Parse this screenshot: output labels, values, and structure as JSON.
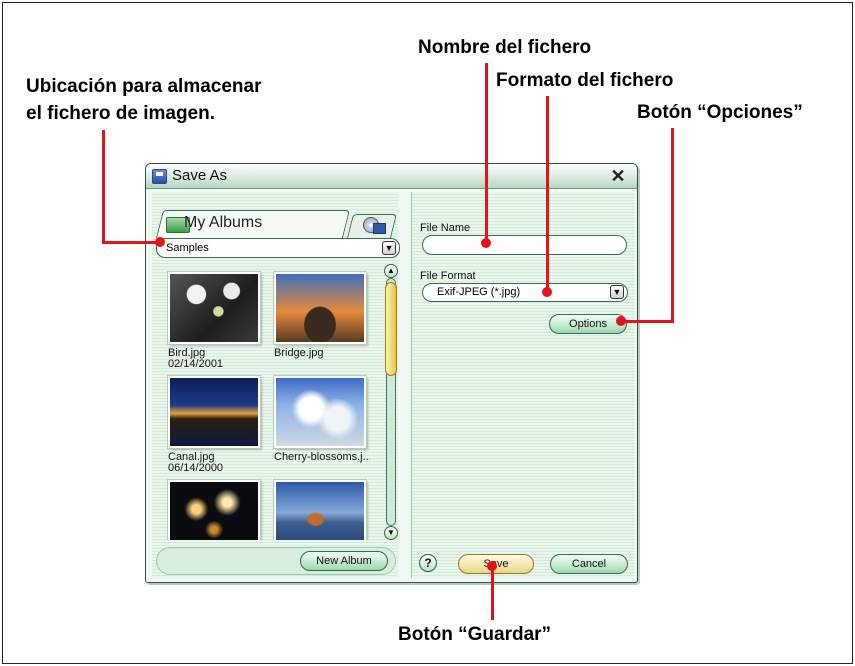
{
  "callouts": {
    "location_line1": "Ubicación para almacenar",
    "location_line2": "el fichero de imagen.",
    "file_name": "Nombre del fichero",
    "file_format": "Formato del fichero",
    "options_button": "Botón “Opciones”",
    "save_button": "Botón “Guardar”"
  },
  "dialog": {
    "title": "Save As",
    "close_glyph": "✕",
    "tabs": [
      {
        "label": "My Albums",
        "icon": "album-icon",
        "active": true
      },
      {
        "label": "",
        "icon": "disc-drive-icon",
        "active": false
      }
    ],
    "location": {
      "value": "Samples"
    },
    "thumbnails": [
      {
        "name": "Bird.jpg",
        "date": "02/14/2001"
      },
      {
        "name": "Bridge.jpg",
        "date": ""
      },
      {
        "name": "Canal.jpg",
        "date": "06/14/2000"
      },
      {
        "name": "Cherry-blossoms.j...",
        "date": ""
      },
      {
        "name": "",
        "date": ""
      },
      {
        "name": "",
        "date": ""
      }
    ],
    "new_album_label": "New Album",
    "file_name_label": "File Name",
    "file_name_value": "",
    "file_format_label": "File Format",
    "file_format_value": "Exif-JPEG (*.jpg)",
    "options_label": "Options",
    "help_label": "?",
    "save_label": "Save",
    "cancel_label": "Cancel"
  },
  "colors": {
    "callout_red": "#e3121b",
    "dialog_bg": "#eef7f0",
    "accent_green": "#9fd7b0",
    "save_yellow": "#e9d682"
  }
}
